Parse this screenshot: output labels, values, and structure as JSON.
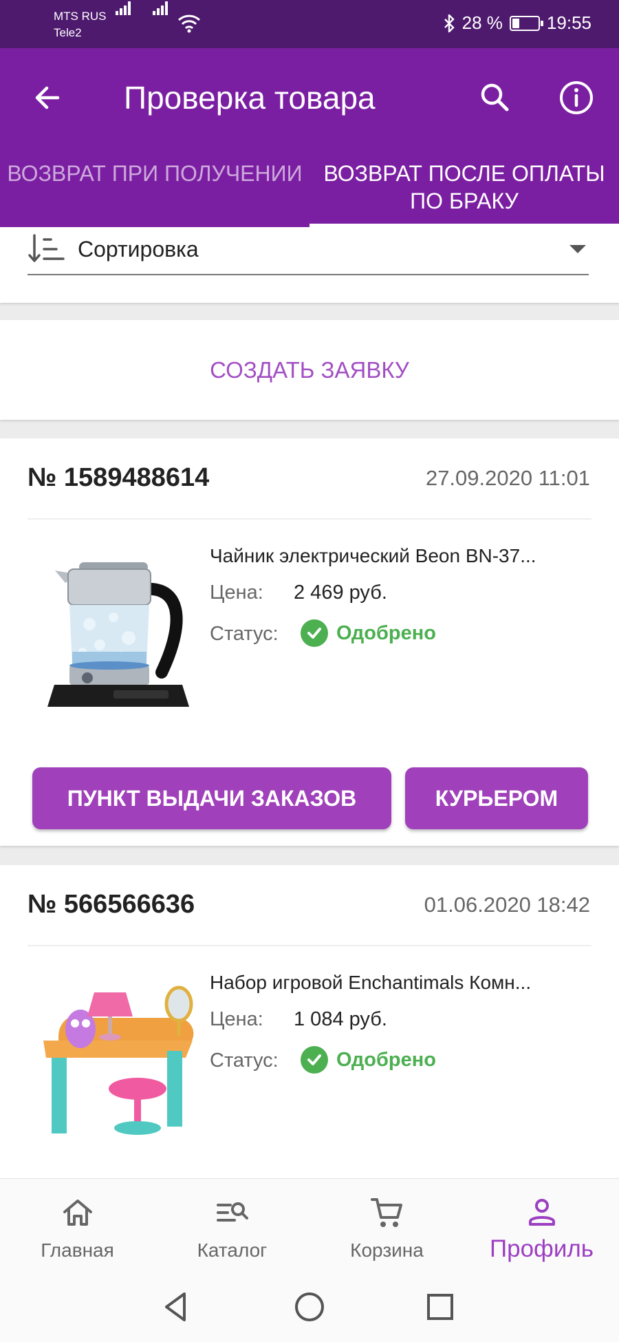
{
  "status_bar": {
    "carrier1": "MTS RUS",
    "carrier2": "Tele2",
    "battery": "28 %",
    "battery_level": 0.28,
    "time": "19:55"
  },
  "header": {
    "title": "Проверка товара",
    "back_icon": "arrow-left-icon",
    "search_icon": "search-icon",
    "info_icon": "info-icon"
  },
  "tabs": [
    {
      "label": "Возврат при получении",
      "active": false
    },
    {
      "label": "Возврат после оплаты по браку",
      "active": true
    }
  ],
  "sort": {
    "label": "Сортировка",
    "icon": "sort-icon"
  },
  "create_request": {
    "label": "Создать заявку"
  },
  "orders": [
    {
      "number": "№ 1589488614",
      "date": "27.09.2020 11:01",
      "product_name": "Чайник электрический Beon BN-37...",
      "price_label": "Цена:",
      "price": "2 469 руб.",
      "status_label": "Статус:",
      "status": "Одобрено",
      "actions": {
        "pickup": "Пункт выдачи заказов",
        "courier": "Курьером"
      }
    },
    {
      "number": "№ 566566636",
      "date": "01.06.2020 18:42",
      "product_name": "Набор игровой Enchantimals Комн...",
      "price_label": "Цена:",
      "price": "1 084 руб.",
      "status_label": "Статус:",
      "status": "Одобрено"
    }
  ],
  "bottom_nav": [
    {
      "label": "Главная",
      "icon": "home-icon",
      "active": false
    },
    {
      "label": "Каталог",
      "icon": "catalog-search-icon",
      "active": false
    },
    {
      "label": "Корзина",
      "icon": "cart-icon",
      "active": false
    },
    {
      "label": "Профиль",
      "icon": "profile-icon",
      "active": true
    }
  ],
  "colors": {
    "status_bar": "#4e1a6e",
    "primary": "#7b1fa2",
    "accent_button": "#a040bb",
    "accent_text": "#a24fc4",
    "success": "#4caf50"
  }
}
